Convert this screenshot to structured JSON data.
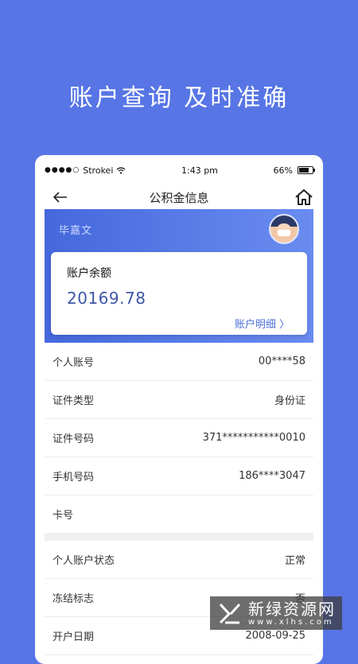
{
  "headline": "账户查询  及时准确",
  "statusbar": {
    "carrier": "Strokei",
    "time": "1:43 pm",
    "battery": "66%"
  },
  "nav": {
    "title": "公积金信息"
  },
  "user": {
    "name": "毕嘉文"
  },
  "balance": {
    "label": "账户余额",
    "value": "20169.78",
    "detail_link": "账户明细 〉"
  },
  "info_rows": [
    {
      "label": "个人账号",
      "value": "00****58"
    },
    {
      "label": "证件类型",
      "value": "身份证"
    },
    {
      "label": "证件号码",
      "value": "371***********0010"
    },
    {
      "label": "手机号码",
      "value": "186****3047"
    },
    {
      "label": "卡号",
      "value": ""
    }
  ],
  "status_rows": [
    {
      "label": "个人账户状态",
      "value": "正常"
    },
    {
      "label": "冻结标志",
      "value": "否"
    },
    {
      "label": "开户日期",
      "value": "2008-09-25"
    }
  ],
  "watermark": {
    "name": "新绿资源网",
    "url": "www.xlhs.com"
  },
  "colors": {
    "background": "#5775e5",
    "panel": "#4568dc",
    "balance_value": "#3f56a8",
    "link": "#4e6fd6"
  },
  "icons": {
    "back": "arrow-left-icon",
    "home": "home-icon",
    "wifi": "wifi-icon",
    "battery": "battery-icon",
    "signal": "signal-dots-icon"
  }
}
